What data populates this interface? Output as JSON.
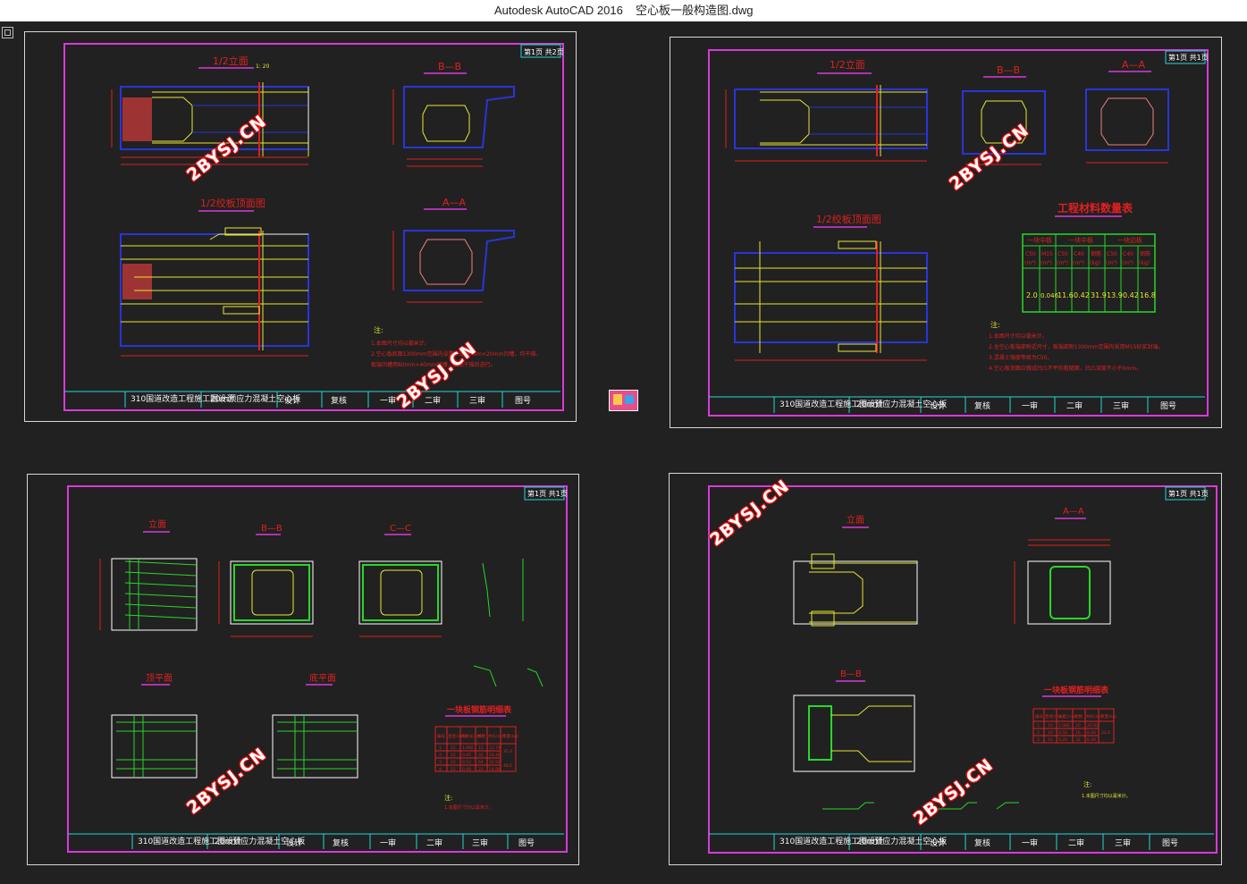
{
  "window": {
    "app_title": "Autodesk AutoCAD 2016",
    "file_name": "空心板一般构造图.dwg"
  },
  "watermark": "2BYSJ.CN",
  "colors": {
    "background": "#212121",
    "frame": "#d83ad8",
    "blue_lines": "#2a34d8",
    "yellow_lines": "#e6e632",
    "red_lines": "#e02020",
    "green_lines": "#28d828",
    "cyan_lines": "#22d8d8"
  },
  "sheets": [
    {
      "page_tag": "第1页 共2页",
      "views": {
        "half_elevation": "1/2立面",
        "section_bb": "B—B",
        "half_top_section": "1/2绞板顶面图",
        "section_aa": "A—A"
      },
      "scale": "1: 20",
      "notes_title": "注:",
      "notes": [
        "1.本图尺寸均以毫米计。",
        "2.空心板底面1300mm范围内设置一道80mm×20mm凹槽，均干燥。",
        "板端凹槽用80mm×40mm凹槽，按图干燥后进行。"
      ],
      "title_block": [
        "310国道改造工程施工图设计",
        "20m预应力混凝土空心板",
        "设计",
        "复核",
        "一审",
        "二审",
        "三审",
        "图号"
      ]
    },
    {
      "page_tag": "第1页 共1页",
      "views": {
        "half_elevation": "1/2立面",
        "section_bb": "B—B",
        "section_aa": "A—A",
        "half_top_section": "1/2绞板顶面图"
      },
      "scale": "1: 20",
      "material_table_title": "工程材料数量表",
      "material_table": {
        "groups": [
          "一块中板",
          "一块中板",
          "一块边板"
        ],
        "headers": [
          "C50",
          "M15",
          "C50",
          "C40",
          "钢筋",
          "C50",
          "C40",
          "钢筋"
        ],
        "units": [
          "(m³)",
          "(m³)",
          "(m³)",
          "(m³)",
          "(kg)",
          "(m³)",
          "(m³)",
          "(kg)"
        ],
        "values": [
          "2.0",
          "0.046",
          "11.6",
          "0.42",
          "31.9",
          "13.9",
          "0.42",
          "16.8"
        ]
      },
      "notes_title": "注:",
      "notes": [
        "1.本图尺寸均以毫米计。",
        "2.全空心板端部附近尺寸，板端部附1300mm范围内采用M15砂浆封端。",
        "3.混凝土强度等级为C50。",
        "4.空心板顶面应做成凹凸不平的粗糙面，凹凸深度不小于6mm。"
      ],
      "title_block": [
        "310国道改造工程施工图设计",
        "20m预应力混凝土空心板",
        "设计",
        "复核",
        "一审",
        "二审",
        "三审",
        "图号"
      ]
    },
    {
      "page_tag": "第1页 共1页",
      "views": {
        "elevation": "立面",
        "section_bb": "B—B",
        "section_cc": "C—C",
        "top_plan": "顶平面",
        "bottom_plan": "底平面"
      },
      "scale": "1: 20",
      "rebar_table_title": "一块板钢筋明细表",
      "rebar_table": {
        "headers": [
          "编号",
          "直径(mm)",
          "每根长(cm)",
          "根数",
          "共长(m)",
          "重量(kg)"
        ],
        "rows": [
          [
            "1",
            "12",
            "1.066",
            "12",
            "12.79"
          ],
          [
            "2",
            "12",
            "0.45",
            "32",
            "14.40"
          ],
          [
            "3",
            "12",
            "0.53",
            "64",
            "33.92"
          ],
          [
            "4",
            "12",
            "0.68",
            "22",
            "14.96"
          ]
        ],
        "totals": [
          "35.4",
          "48.6"
        ]
      },
      "notes_title": "注:",
      "notes": [
        "1.本图尺寸均以毫米计。"
      ],
      "title_block": [
        "310国道改造工程施工图设计",
        "20m预应力混凝土空心板",
        "设计",
        "复核",
        "一审",
        "二审",
        "三审",
        "图号"
      ]
    },
    {
      "page_tag": "第1页 共1页",
      "views": {
        "elevation": "立面",
        "section_aa": "A—A",
        "section_bb": "B—B"
      },
      "scale": "1: 20",
      "rebar_table_title": "一块板钢筋明细表",
      "rebar_table": {
        "headers": [
          "编号",
          "直径(mm)",
          "长度(cm)",
          "根数",
          "共长(m)",
          "重量(kg)"
        ],
        "rows": [
          [
            "1",
            "10",
            "1.066",
            "20",
            "20.92"
          ],
          [
            "2",
            "10",
            "0.50",
            "16",
            "8.00"
          ],
          [
            "3",
            "10",
            "0.20",
            "32",
            "6.40"
          ]
        ],
        "totals": [
          "22.4"
        ]
      },
      "notes_title": "注:",
      "notes": [
        "1.本图尺寸均以毫米计。"
      ],
      "title_block": [
        "310国道改造工程施工图设计",
        "20m预应力混凝土空心板",
        "设计",
        "复核",
        "一审",
        "二审",
        "三审",
        "图号"
      ]
    }
  ]
}
